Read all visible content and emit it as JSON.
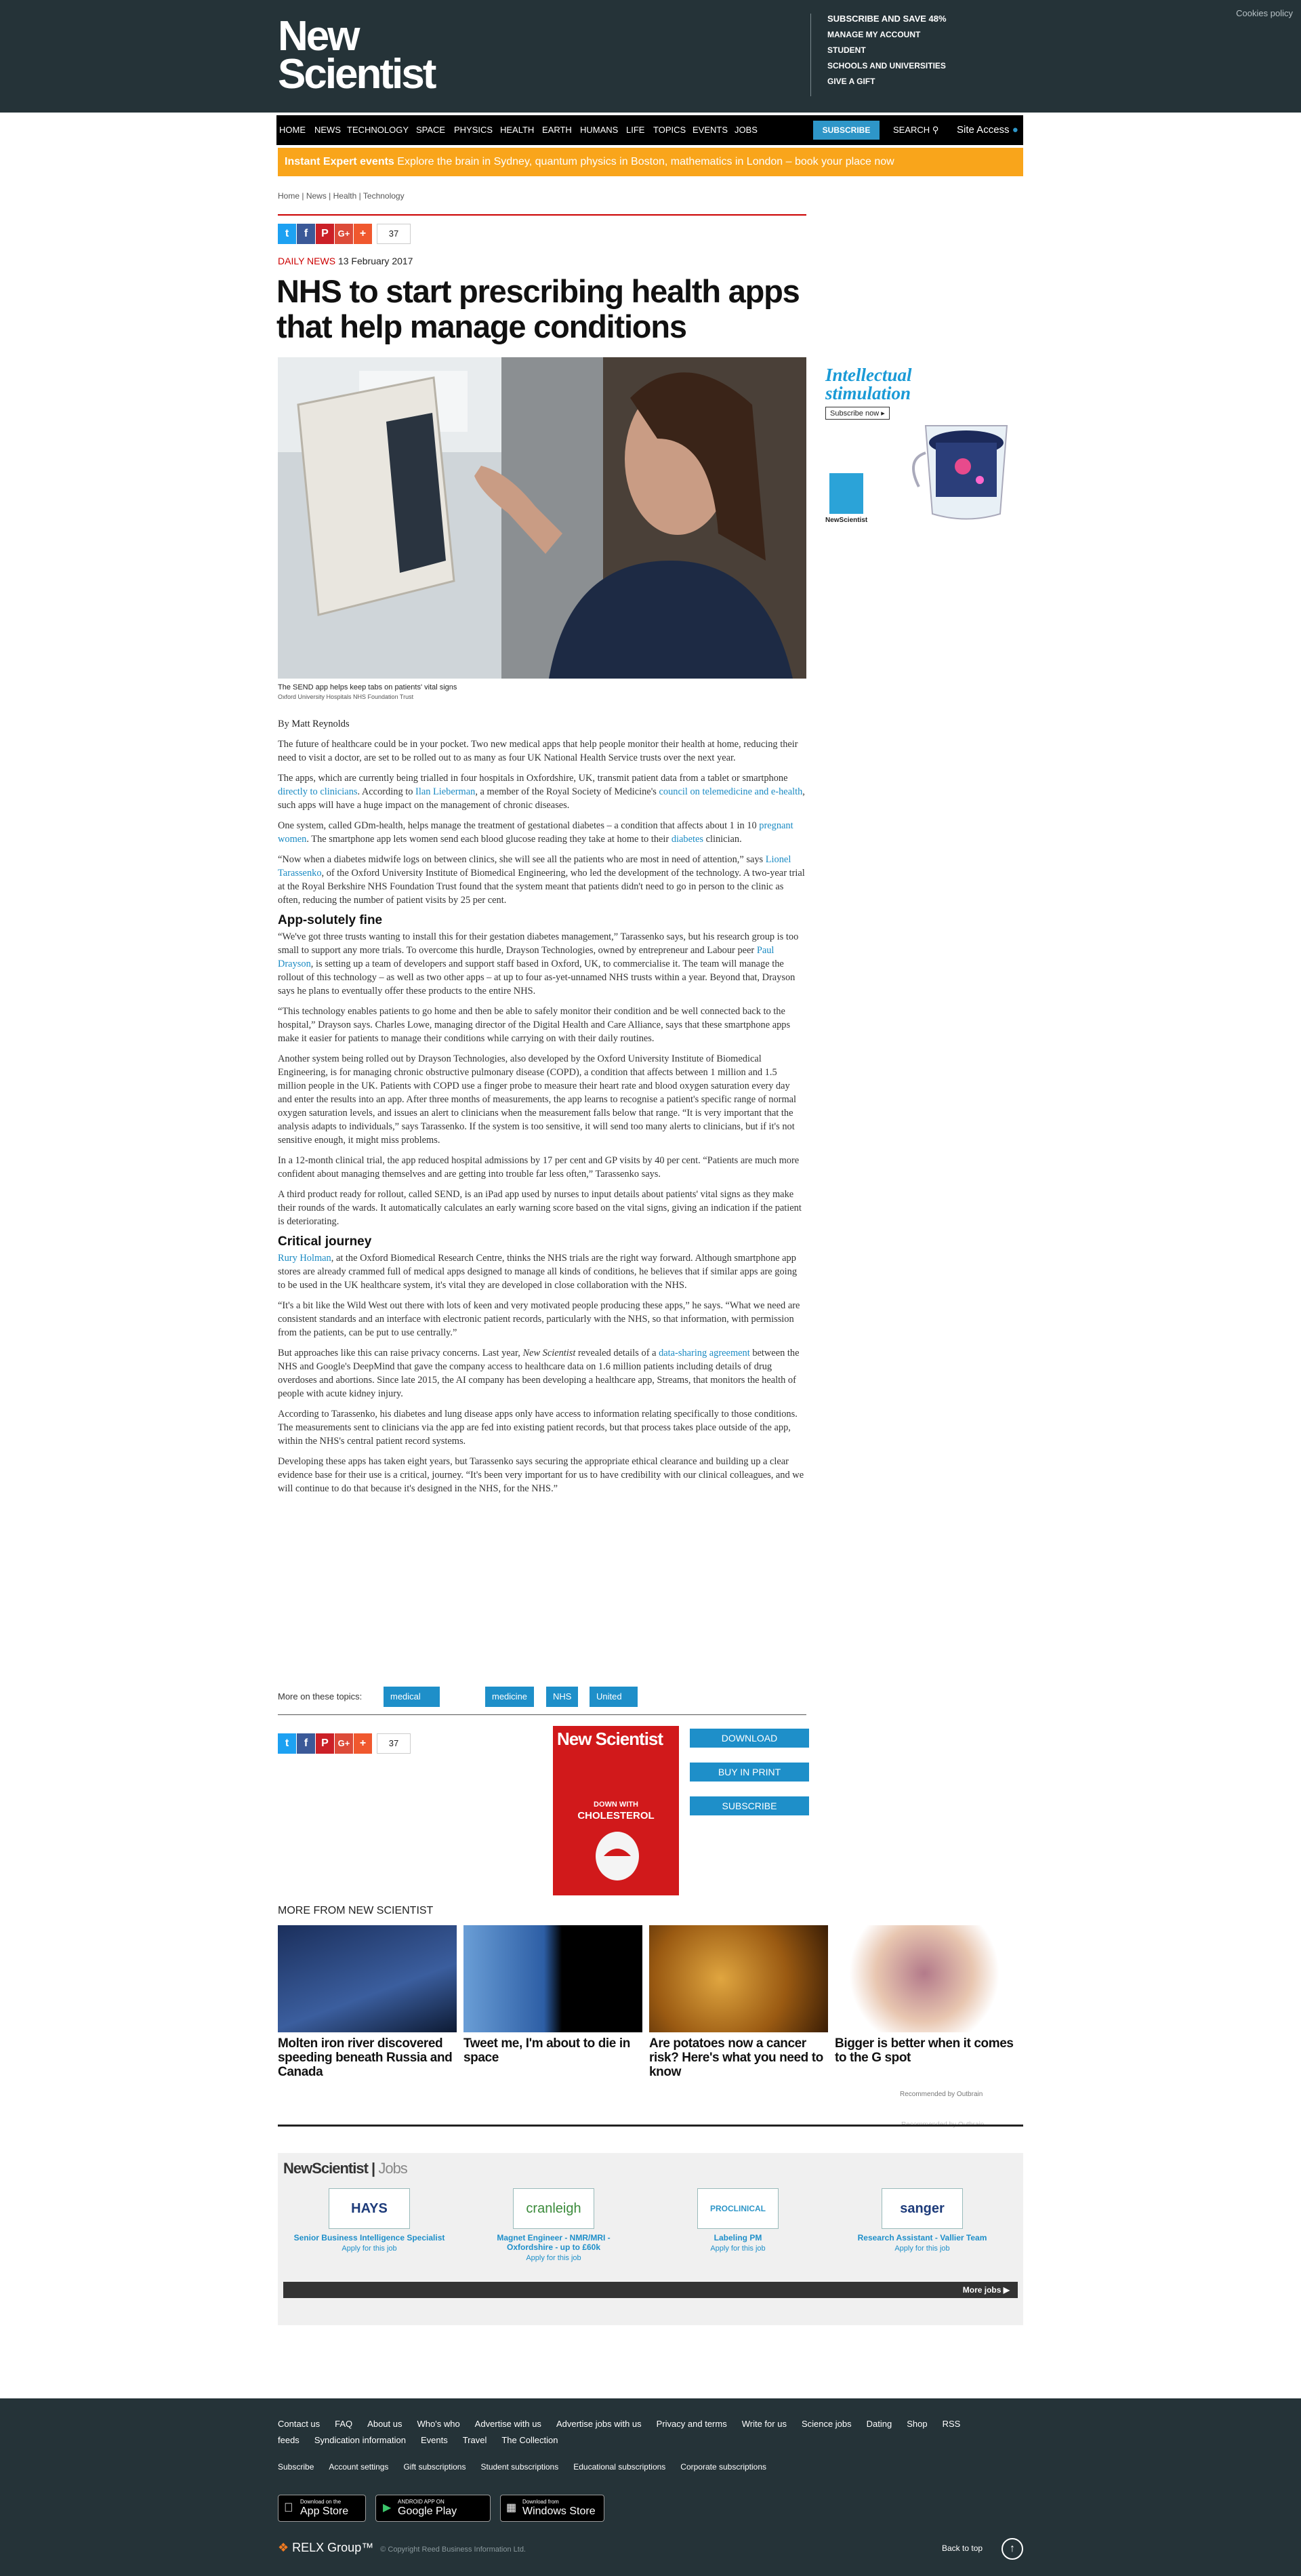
{
  "header": {
    "cookies": "Cookies policy",
    "logo_line1": "New",
    "logo_line2": "Scientist",
    "account_links": [
      "SUBSCRIBE AND SAVE 48%",
      "MANAGE MY ACCOUNT",
      "STUDENT",
      "SCHOOLS AND UNIVERSITIES",
      "GIVE A GIFT"
    ]
  },
  "nav": {
    "items": [
      "HOME",
      "NEWS",
      "TECHNOLOGY",
      "SPACE",
      "PHYSICS",
      "HEALTH",
      "EARTH",
      "HUMANS",
      "LIFE",
      "TOPICS",
      "EVENTS",
      "JOBS"
    ],
    "subscribe": "SUBSCRIBE",
    "search": "SEARCH",
    "site_access": "Site Access"
  },
  "promo": {
    "bold": "Instant Expert events",
    "text": " Explore the brain in Sydney, quantum physics in Boston, mathematics in London – book your place now"
  },
  "breadcrumb": [
    "Home",
    "News",
    "Health",
    "Technology"
  ],
  "share": {
    "count": "37"
  },
  "article": {
    "kicker": "DAILY NEWS",
    "date": "13 February 2017",
    "title": "NHS to start prescribing health apps that help manage conditions",
    "caption": "The SEND app helps keep tabs on patients' vital signs",
    "credit": "Oxford University Hospitals NHS Foundation Trust",
    "by": "By ",
    "author": "Matt Reynolds",
    "p1": "The future of healthcare could be in your pocket. Two new medical apps that help people monitor their health at home, reducing their need to visit a doctor, are set to be rolled out to as many as four UK National Health Service trusts over the next year.",
    "p2a": "The apps, which are currently being trialled in four hospitals in Oxfordshire, UK, transmit patient data from a tablet or smartphone ",
    "p2l1": "directly to clinicians",
    "p2b": ". According to ",
    "p2l2": "Ilan Lieberman",
    "p2c": ", a member of the Royal Society of Medicine's ",
    "p2l3": "council on telemedicine and e-health",
    "p2d": ", such apps will have a huge impact on the management of chronic diseases.",
    "p3a": "One system, called GDm-health, helps manage the treatment of gestational diabetes – a condition that affects about 1 in 10 ",
    "p3l1": "pregnant women",
    "p3b": ". The smartphone app lets women send each blood glucose reading they take at home to their ",
    "p3l2": "diabetes",
    "p3c": " clinician.",
    "p4a": "“Now when a diabetes midwife logs on between clinics, she will see all the patients who are most in need of attention,” says ",
    "p4l1": "Lionel Tarassenko",
    "p4b": ", of the Oxford University Institute of Biomedical Engineering, who led the development of the technology. A two-year trial at the Royal Berkshire NHS Foundation Trust found that the system meant that patients didn't need to go in person to the clinic as often, reducing the number of patient visits by 25 per cent.",
    "h1": "App-solutely fine",
    "p5a": "“We've got three trusts wanting to install this for their gestation diabetes management,” Tarassenko says, but his research group is too small to support any more trials. To overcome this hurdle, Drayson Technologies, owned by entrepreneur and Labour peer ",
    "p5l1": "Paul Drayson",
    "p5b": ", is setting up a team of developers and support staff based in Oxford, UK, to commercialise it. The team will manage the rollout of this technology – as well as two other apps – at up to four as-yet-unnamed NHS trusts within a year. Beyond that, Drayson says he plans to eventually offer these products to the entire NHS.",
    "p6": "“This technology enables patients to go home and then be able to safely monitor their condition and be well connected back to the hospital,” Drayson says. Charles Lowe, managing director of the Digital Health and Care Alliance, says that these smartphone apps make it easier for patients to manage their conditions while carrying on with their daily routines.",
    "p7": "Another system being rolled out by Drayson Technologies, also developed by the Oxford University Institute of Biomedical Engineering, is for managing chronic obstructive pulmonary disease (COPD), a condition that affects between 1 million and 1.5 million people in the UK. Patients with COPD use a finger probe to measure their heart rate and blood oxygen saturation every day and enter the results into an app. After three months of measurements, the app learns to recognise a patient's specific range of normal oxygen saturation levels, and issues an alert to clinicians when the measurement falls below that range. “It is very important that the analysis adapts to individuals,” says Tarassenko. If the system is too sensitive, it will send too many alerts to clinicians, but if it's not sensitive enough, it might miss problems.",
    "p8": "In a 12-month clinical trial, the app reduced hospital admissions by 17 per cent and GP visits by 40 per cent. “Patients are much more confident about managing themselves and are getting into trouble far less often,” Tarassenko says.",
    "p9": "A third product ready for rollout, called SEND, is an iPad app used by nurses to input details about patients' vital signs as they make their rounds of the wards. It automatically calculates an early warning score based on the vital signs, giving an indication if the patient is deteriorating.",
    "h2": "Critical journey",
    "p10l1": "Rury Holman",
    "p10a": ", at the Oxford Biomedical Research Centre, thinks the NHS trials are the right way forward. Although smartphone app stores are already crammed full of medical apps designed to manage all kinds of conditions, he believes that if similar apps are going to be used in the UK healthcare system, it's vital they are developed in close collaboration with the NHS.",
    "p11": "“It's a bit like the Wild West out there with lots of keen and very motivated people producing these apps,” he says. “What we need are consistent standards and an interface with electronic patient records, particularly with the NHS, so that information, with permission from the patients, can be put to use centrally.”",
    "p12a": "But approaches like this can raise privacy concerns. Last year, ",
    "p12i": "New Scientist",
    "p12b": " revealed details of a ",
    "p12l1": "data-sharing agreement",
    "p12c": " between the NHS and Google's DeepMind that gave the company access to healthcare data on 1.6 million patients including details of drug overdoses and abortions. Since late 2015, the AI company has been developing a healthcare app, Streams, that monitors the health of people with acute kidney injury.",
    "p13": "According to Tarassenko, his diabetes and lung disease apps only have access to information relating specifically to those conditions. The measurements sent to clinicians via the app are fed into existing patient records, but that process takes place outside of the app, within the NHS's central patient record systems.",
    "p14": "Developing these apps has taken eight years, but Tarassenko says securing the appropriate ethical clearance and building up a clear evidence base for their use is a critical, journey. “It's been very important for us to have credibility with our clinical colleagues, and we will continue to do that because it's designed in the NHS, for the NHS.”"
  },
  "topics": {
    "label": "More on these topics:",
    "tags": [
      "medical technology",
      "medicine",
      "NHS",
      "United Kingdom"
    ]
  },
  "ad": {
    "headline1": "Intellectual",
    "headline2": "stimulation",
    "button": "Subscribe now",
    "brand": "NewScientist"
  },
  "magazine": {
    "title": "New Scientist",
    "cover_line1": "DOWN WITH",
    "cover_line2": "CHOLESTEROL",
    "download": "DOWNLOAD",
    "print": "BUY IN PRINT",
    "subscribe": "SUBSCRIBE"
  },
  "more": {
    "heading": "MORE FROM NEW SCIENTIST",
    "items": [
      {
        "title": "Molten iron river discovered speeding beneath Russia and Canada"
      },
      {
        "title": "Tweet me, I'm about to die in space"
      },
      {
        "title": "Are potatoes now a cancer risk? Here's what you need to know"
      },
      {
        "title": "Bigger is better when it comes to the G spot"
      }
    ],
    "recommended": "Recommended by Outbrain"
  },
  "jobs": {
    "logo1": "NewScientist",
    "logo2": "Jobs",
    "items": [
      {
        "company": "HAYS",
        "title": "Senior Business Intelligence Specialist",
        "apply": "Apply for this job"
      },
      {
        "company": "cranleigh",
        "title": "Magnet Engineer - NMR/MRI - Oxfordshire - up to £60k",
        "apply": "Apply for this job"
      },
      {
        "company": "PROCLINICAL",
        "title": "Labeling PM",
        "apply": "Apply for this job"
      },
      {
        "company": "sanger",
        "title": "Research Assistant - Vallier Team",
        "apply": "Apply for this job"
      }
    ],
    "more": "More jobs ▶"
  },
  "footer": {
    "row1": [
      "Contact us",
      "FAQ",
      "About us",
      "Who's who",
      "Advertise with us",
      "Advertise jobs with us",
      "Privacy and terms",
      "Write for us",
      "Science jobs",
      "Dating",
      "Shop",
      "RSS"
    ],
    "row1b": [
      "feeds",
      "Syndication information",
      "Events",
      "Travel",
      "The Collection"
    ],
    "row2": [
      "Subscribe",
      "Account settings",
      "Gift subscriptions",
      "Student subscriptions",
      "Educational subscriptions",
      "Corporate subscriptions"
    ],
    "stores": [
      {
        "small": "Download on the",
        "big": "App Store"
      },
      {
        "small": "ANDROID APP ON",
        "big": "Google Play"
      },
      {
        "small": "Download from",
        "big": "Windows Store"
      }
    ],
    "relx": "RELX Group™",
    "copyright": "© Copyright Reed Business Information Ltd.",
    "back_to_top": "Back to top"
  },
  "colors": {
    "header_bg": "#253338",
    "promo": "#f9a51b",
    "accent": "#1e8fc9",
    "kicker": "#cc0000"
  }
}
